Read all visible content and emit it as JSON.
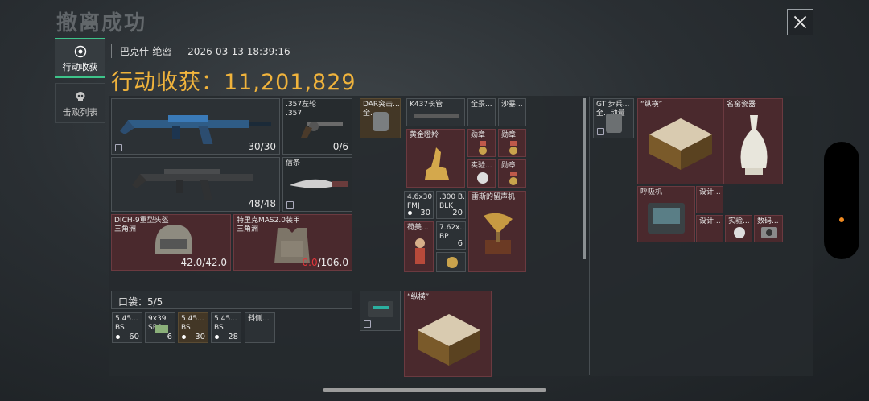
{
  "header": {
    "bg_title": "撤离成功",
    "map_name": "巴克什-绝密",
    "timestamp": "2026-03-13 18:39:16",
    "haul_label": "行动收获：",
    "haul_value": "11,201,829"
  },
  "tabs": [
    {
      "label": "行动收获",
      "active": true
    },
    {
      "label": "击败列表",
      "active": false
    }
  ],
  "equipment": {
    "weapon1_count": "30/30",
    "revolver_name": ".357左轮\n.357",
    "revolver_count": "0/6",
    "weapon2_count": "48/48",
    "letter_name": "信条",
    "helmet_name": "DICH-9重型头盔\n三角洲",
    "helmet_durability": "42.0/42.0",
    "armor_name": "特里克MAS2.0装甲\n三角洲",
    "armor_current": "0.0",
    "armor_max": "/106.0"
  },
  "pocket": {
    "label": "口袋：5/5",
    "items": [
      {
        "name": "5.45...\nBS",
        "count": "60"
      },
      {
        "name": "9x39\nSP6",
        "count": "6"
      },
      {
        "name": "5.45...\nBS",
        "count": "30"
      },
      {
        "name": "5.45...\nBS",
        "count": "28"
      },
      {
        "name": "斜侧...",
        "count": ""
      }
    ]
  },
  "backpack": {
    "dar_name": "DAR突击...\n全...",
    "k437_name": "K437长管",
    "full_scope": "全景...",
    "sand_name": "沙暴...",
    "gold_name": "黄金瞪羚",
    "medal1": "勋章",
    "medal2": "勋章",
    "lab1": "实验...",
    "medal3": "勋章",
    "ammo1_name": "4.6x30\nFMJ",
    "ammo1_count": "30",
    "ammo2_name": ".300 B...\nBLK",
    "ammo2_count": "20",
    "gramophone": "雷斯的留声机",
    "dutch_name": "荷美...",
    "ammo3_name": "7.62x...\nBP",
    "ammo3_count": "6"
  },
  "secure": {
    "chess_name": "“纵横”"
  },
  "storage": {
    "gti_name": "GTI步兵...\n全...动量",
    "chess_name": "“纵横”",
    "vase_name": "名窑瓷器",
    "respirator": "呼吸机",
    "design1": "设计...",
    "design2": "设计...",
    "lab2": "实验...",
    "camera": "数码..."
  },
  "colors": {
    "accent_gold": "#f0b33c",
    "tab_accent": "#3ec48a",
    "red_slot": "#4a292d",
    "damage_red": "#e0353a"
  }
}
